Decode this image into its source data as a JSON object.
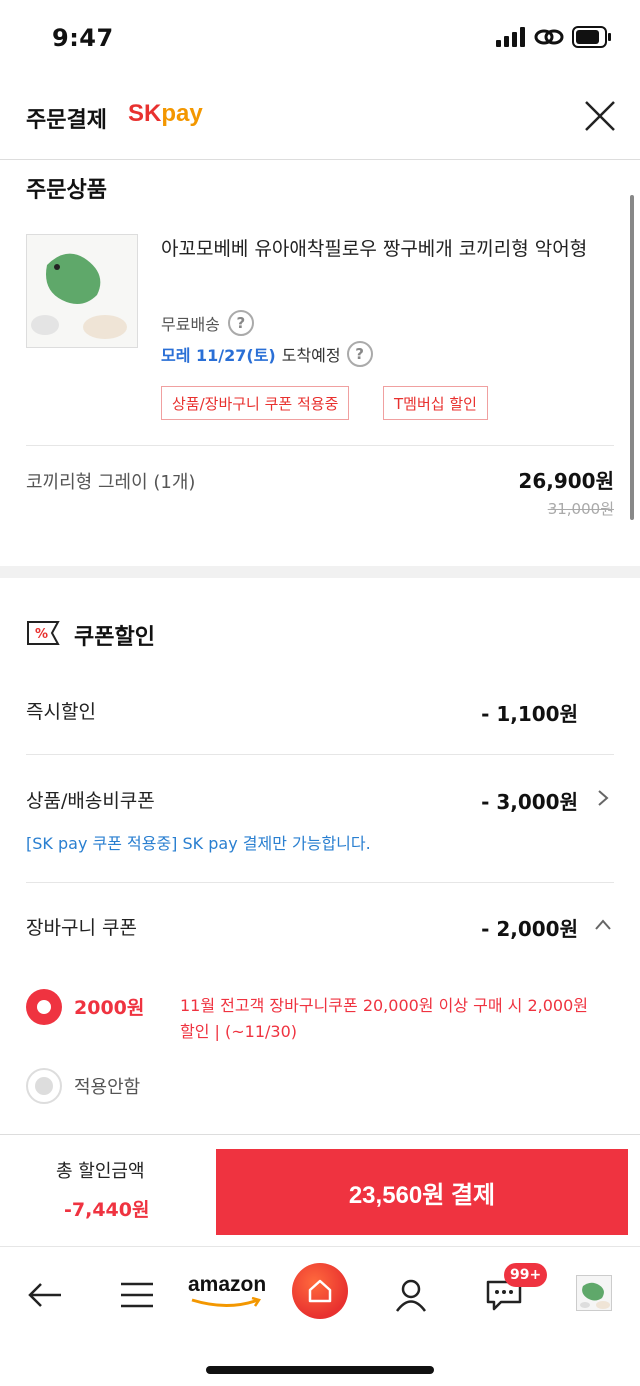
{
  "status": {
    "time": "9:47"
  },
  "header": {
    "title": "주문결제",
    "brand_sk": "SK",
    "brand_pay": "pay"
  },
  "order": {
    "section_title": "주문상품",
    "product_name": "아꼬모베베 유아애착필로우 짱구베개 코끼리형 악어형",
    "shipping": "무료배송",
    "arrival_date": "모레 11/27(토)",
    "arrival_suffix": "도착예정",
    "tags": [
      "상품/장바구니 쿠폰 적용중",
      "T멤버십 할인"
    ],
    "option": "코끼리형 그레이 (1개)",
    "price": "26,900원",
    "original_price": "31,000원"
  },
  "coupon": {
    "section_title": "쿠폰할인",
    "rows": [
      {
        "label": "즉시할인",
        "value": "- 1,100원"
      },
      {
        "label": "상품/배송비쿠폰",
        "value": "- 3,000원"
      },
      {
        "label": "장바구니 쿠폰",
        "value": "- 2,000원"
      }
    ],
    "info": "[SK pay 쿠폰 적용중] SK pay 결제만 가능합니다.",
    "options": [
      {
        "amount": "2000원",
        "desc": "11월 전고객 장바구니쿠폰 20,000원 이상 구매 시 2,000원 할인 | (~11/30)",
        "selected": true
      },
      {
        "label": "적용안함",
        "selected": false
      }
    ]
  },
  "footer": {
    "total_label": "총 할인금액",
    "total_discount": "-7,440원",
    "pay_button": "23,560원 결제"
  },
  "nav": {
    "amazon": "amazon",
    "badge": "99+"
  },
  "colors": {
    "accent": "#ef3340",
    "link": "#2a7fd0",
    "brand_orange": "#f39700"
  }
}
